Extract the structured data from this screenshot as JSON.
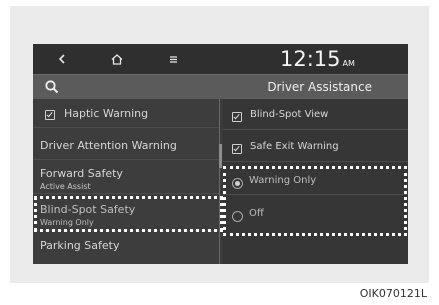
{
  "topbar": {
    "back_icon": "chevron-left-icon",
    "home_icon": "home-icon",
    "menu_icon": "menu-icon",
    "time": "12:15",
    "ampm": "AM"
  },
  "header": {
    "search_icon": "search-icon",
    "title": "Driver Assistance"
  },
  "left_menu": [
    {
      "label": "Haptic Warning",
      "checked": true
    },
    {
      "label": "Driver Attention Warning"
    },
    {
      "label": "Forward Safety",
      "sub": "Active Assist"
    },
    {
      "label": "Blind-Spot Safety",
      "sub": "Warning Only",
      "highlighted": true
    },
    {
      "label": "Parking Safety"
    }
  ],
  "right_menu": {
    "checkboxes": [
      {
        "label": "Blind-Spot View",
        "checked": true
      },
      {
        "label": "Safe Exit Warning",
        "checked": true
      }
    ],
    "radios": [
      {
        "label": "Warning Only",
        "selected": true
      },
      {
        "label": "Off",
        "selected": false
      }
    ]
  },
  "caption": "OIK070121L"
}
